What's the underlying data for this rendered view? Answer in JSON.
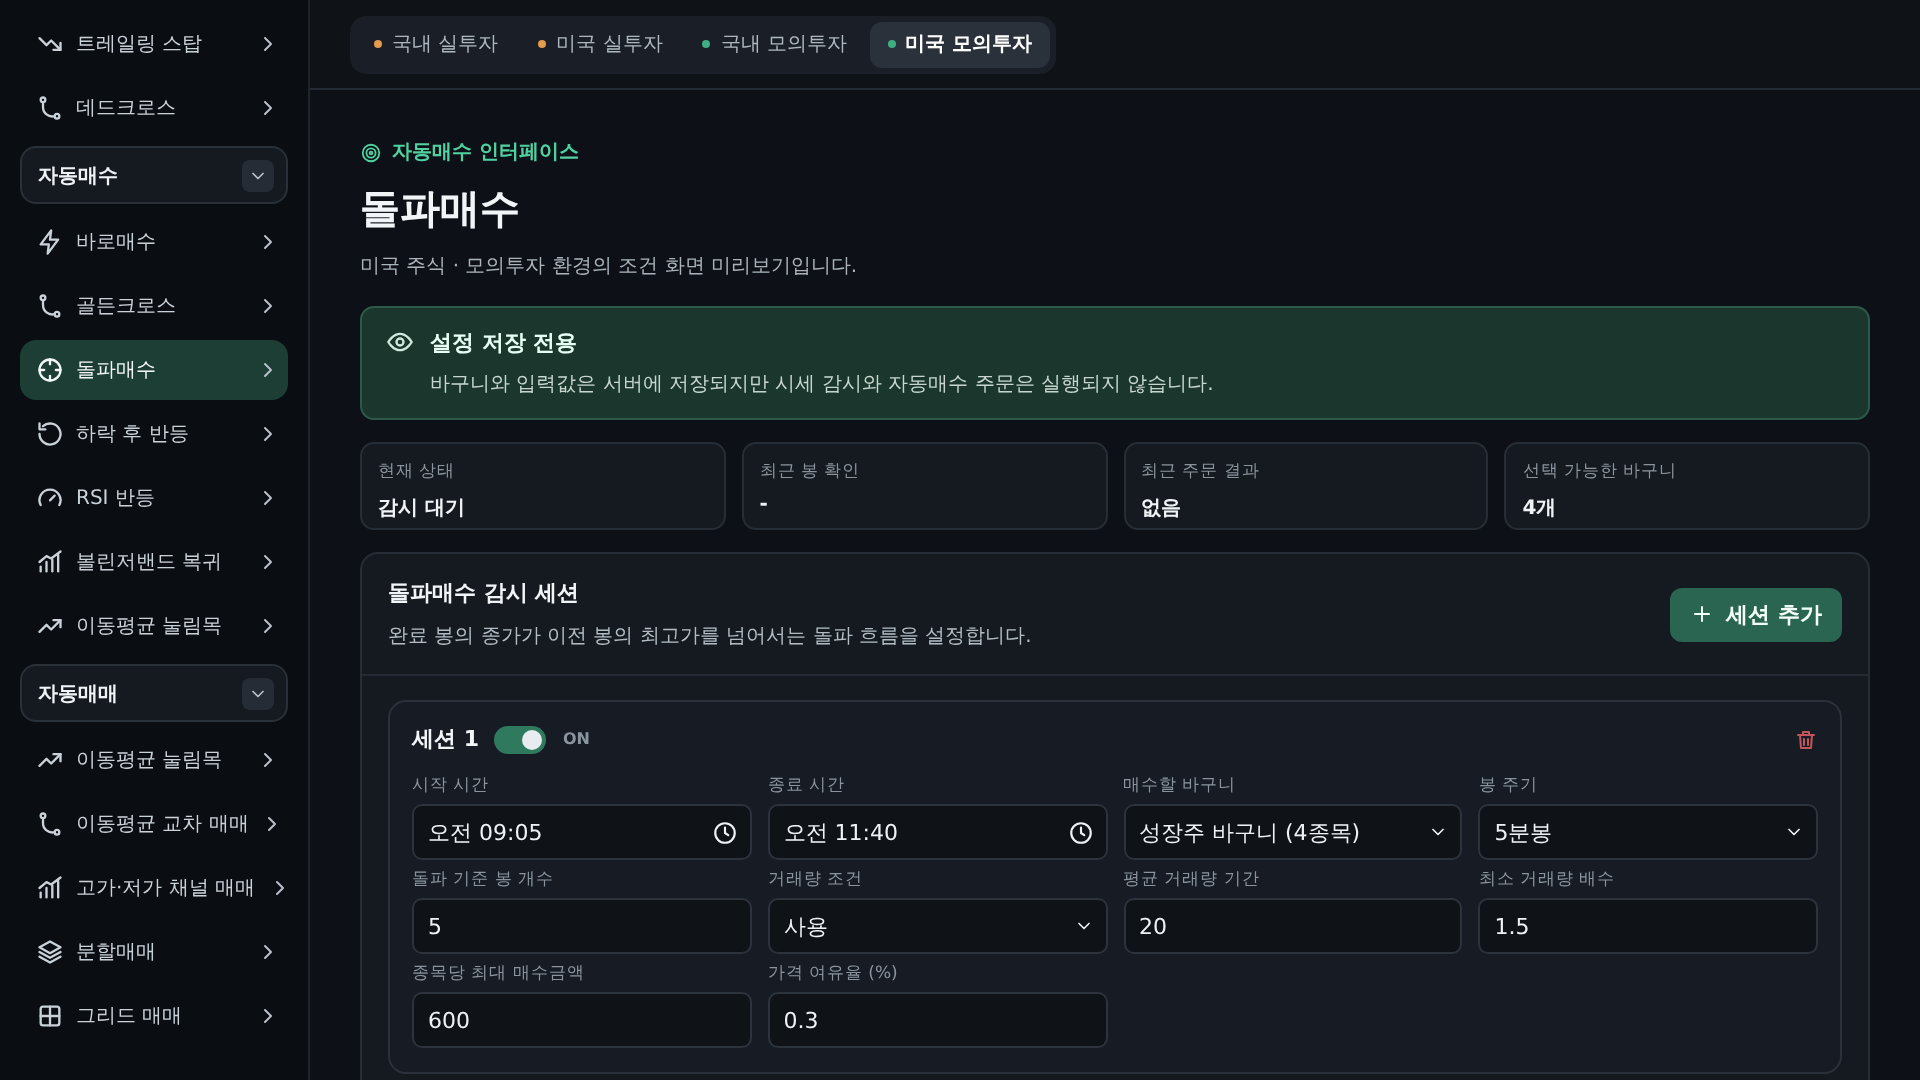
{
  "sidebar": {
    "items": [
      {
        "kind": "item",
        "label": "트레일링 스탑",
        "selected": false
      },
      {
        "kind": "item",
        "label": "데드크로스",
        "selected": false
      },
      {
        "kind": "group",
        "label": "자동매수",
        "expanded": true,
        "children": [
          {
            "kind": "item",
            "label": "바로매수",
            "selected": false
          },
          {
            "kind": "item",
            "label": "골든크로스",
            "selected": false
          },
          {
            "kind": "item",
            "label": "돌파매수",
            "selected": true
          },
          {
            "kind": "item",
            "label": "하락 후 반등",
            "selected": false
          },
          {
            "kind": "item",
            "label": "RSI 반등",
            "selected": false
          },
          {
            "kind": "item",
            "label": "볼린저밴드 복귀",
            "selected": false
          },
          {
            "kind": "item",
            "label": "이동평균 눌림목",
            "selected": false
          }
        ]
      },
      {
        "kind": "group",
        "label": "자동매매",
        "expanded": true,
        "children": [
          {
            "kind": "item",
            "label": "이동평균 눌림목",
            "selected": false
          },
          {
            "kind": "item",
            "label": "이동평균 교차 매매",
            "selected": false
          },
          {
            "kind": "item",
            "label": "고가·저가 채널 매매",
            "selected": false
          },
          {
            "kind": "item",
            "label": "분할매매",
            "selected": false
          },
          {
            "kind": "item",
            "label": "그리드 매매",
            "selected": false
          }
        ]
      }
    ]
  },
  "tabs": [
    {
      "label": "국내 실투자",
      "selected": false,
      "color": "#e59a4c"
    },
    {
      "label": "미국 실투자",
      "selected": false,
      "color": "#e59a4c"
    },
    {
      "label": "국내 모의투자",
      "selected": false,
      "color": "#3fae82"
    },
    {
      "label": "미국 모의투자",
      "selected": true,
      "color": "#3fae82"
    }
  ],
  "header": {
    "eyebrow": "자동매수 인터페이스",
    "title": "돌파매수",
    "subtitle": "미국 주식 · 모의투자 환경의 조건 화면 미리보기입니다."
  },
  "notice": {
    "title": "설정 저장 전용",
    "text": "바구니와 입력값은 서버에 저장되지만 시세 감시와 자동매수 주문은 실행되지 않습니다."
  },
  "stats": [
    {
      "label": "현재 상태",
      "value": "감시 대기"
    },
    {
      "label": "최근 봉 확인",
      "value": "-"
    },
    {
      "label": "최근 주문 결과",
      "value": "없음"
    },
    {
      "label": "선택 가능한 바구니",
      "value": "4개"
    }
  ],
  "panel": {
    "title": "돌파매수 감시 세션",
    "description": "완료 봉의 종가가 이전 봉의 최고가를 넘어서는 돌파 흐름을 설정합니다.",
    "add_button": "세션 추가",
    "sessions": [
      {
        "title": "세션 1",
        "on": true,
        "toggle_label": "ON",
        "fields": [
          {
            "label": "시작 시간",
            "kind": "time",
            "value": "오전 09:05"
          },
          {
            "label": "종료 시간",
            "kind": "time",
            "value": "오전 11:40"
          },
          {
            "label": "매수할 바구니",
            "kind": "select",
            "value": "성장주 바구니 (4종목)"
          },
          {
            "label": "봉 주기",
            "kind": "select",
            "value": "5분봉"
          },
          {
            "label": "돌파 기준 봉 개수",
            "kind": "number",
            "value": "5"
          },
          {
            "label": "거래량 조건",
            "kind": "select",
            "value": "사용"
          },
          {
            "label": "평균 거래량 기간",
            "kind": "number",
            "value": "20"
          },
          {
            "label": "최소 거래량 배수",
            "kind": "number",
            "value": "1.5"
          },
          {
            "label": "종목당 최대 매수금액",
            "kind": "number",
            "value": "600"
          },
          {
            "label": "가격 여유율 (%)",
            "kind": "number",
            "value": "0.3"
          }
        ]
      }
    ]
  }
}
